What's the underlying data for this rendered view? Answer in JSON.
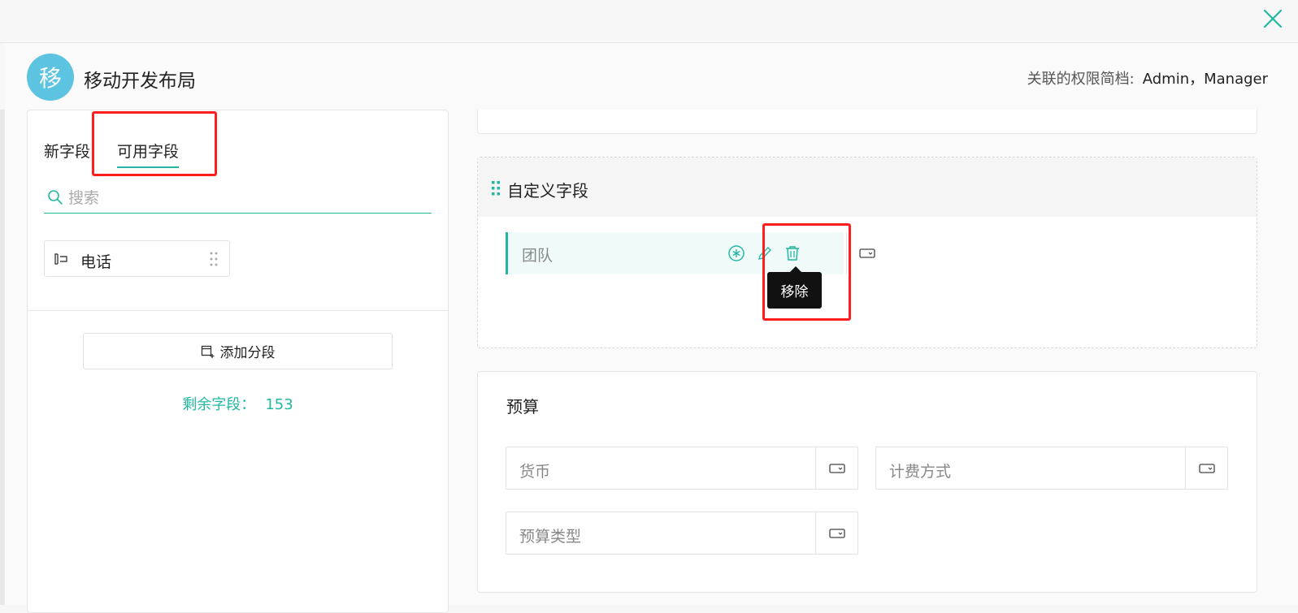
{
  "header": {
    "avatar_letter": "移",
    "layout_title": "移动开发布局",
    "profiles_label": "关联的权限简档:",
    "profiles_value": "Admin，Manager"
  },
  "sidebar": {
    "tabs": [
      {
        "label": "新字段",
        "active": false
      },
      {
        "label": "可用字段",
        "active": true
      }
    ],
    "search": {
      "placeholder": "搜索",
      "value": ""
    },
    "available_fields": [
      {
        "label": "电话",
        "icon": "phone-field-icon"
      }
    ],
    "add_section_label": "添加分段",
    "remaining_label": "剩余字段：",
    "remaining_count": "153"
  },
  "canvas": {
    "custom_section": {
      "title": "自定义字段",
      "fields": [
        {
          "label": "团队",
          "actions": [
            "mandatory-icon",
            "edit-icon",
            "delete-icon"
          ]
        }
      ],
      "tooltip": "移除"
    },
    "budget_section": {
      "title": "预算",
      "fields": [
        {
          "label": "货币"
        },
        {
          "label": "计费方式"
        },
        {
          "label": "预算类型"
        }
      ]
    }
  },
  "colors": {
    "accent": "#23b7a1",
    "avatar_bg": "#5cc3e0",
    "annotation": "#ff1e1e",
    "tooltip_bg": "#111111"
  }
}
